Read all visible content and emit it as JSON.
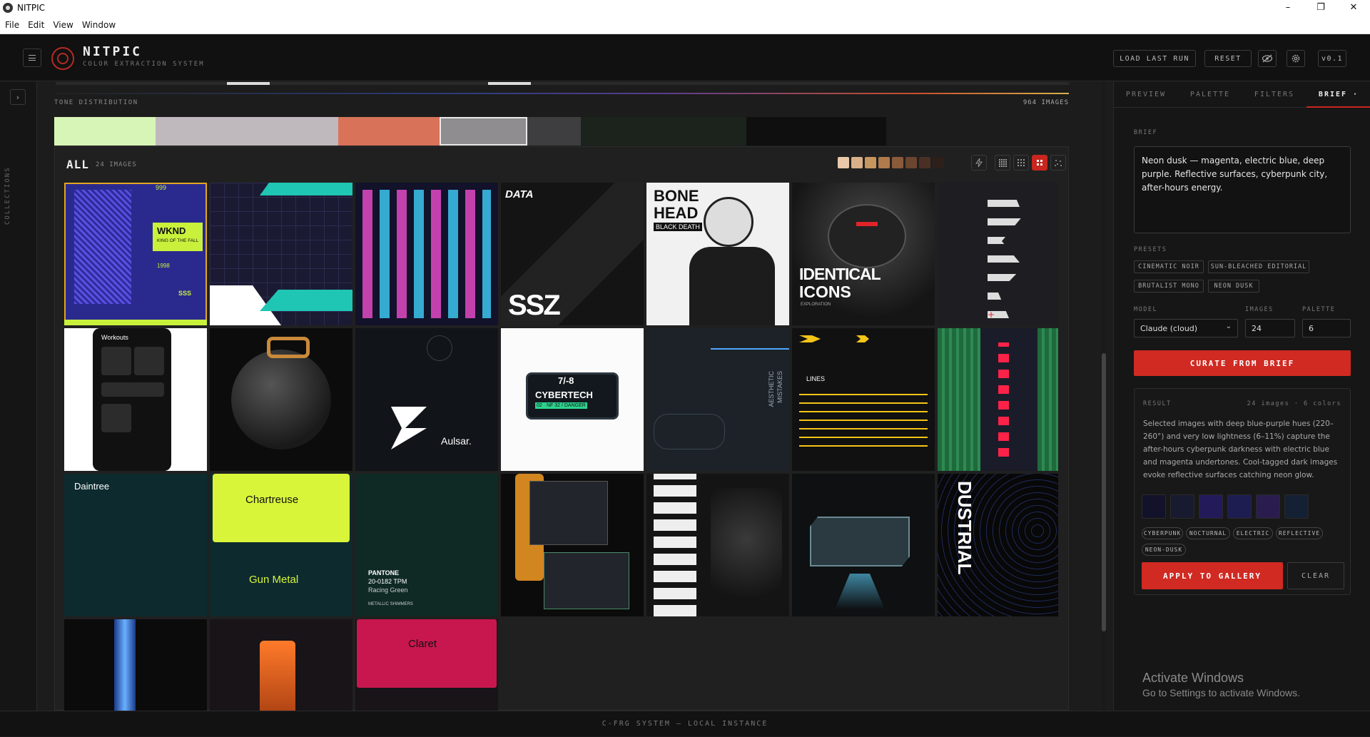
{
  "window": {
    "title": "NITPIC",
    "controls": [
      "–",
      "❐",
      "✕"
    ]
  },
  "menubar": {
    "items": [
      "File",
      "Edit",
      "View",
      "Window"
    ]
  },
  "header": {
    "brand": "NITPIC",
    "subtitle": "COLOR EXTRACTION SYSTEM",
    "load_last_run": "LOAD LAST RUN",
    "reset": "RESET",
    "version": "v0.1",
    "icons": [
      "menu-icon",
      "logo-icon",
      "eye-off-icon",
      "gear-icon"
    ]
  },
  "rail": {
    "expand": "›",
    "label": "COLLECTIONS"
  },
  "tone": {
    "label": "TONE DISTRIBUTION",
    "count": "964 IMAGES",
    "segments": [
      {
        "color": "#d8f5b8",
        "share": 0.1
      },
      {
        "color": "#bfb9be",
        "share": 0.18
      },
      {
        "color": "#d8735a",
        "share": 0.1
      },
      {
        "color": "#8f8d90",
        "share": 0.086,
        "selected": true
      },
      {
        "color": "#3e3e40",
        "share": 0.053
      },
      {
        "color": "#1c221c",
        "share": 0.163
      },
      {
        "color": "#0f0f0f",
        "share": 0.138
      }
    ]
  },
  "gallery": {
    "title": "ALL",
    "count": "24 IMAGES",
    "swatches": [
      "#e9c9a8",
      "#d8b08a",
      "#c7965f",
      "#b07a4c",
      "#8a5a3a",
      "#6b4530",
      "#4a2f24",
      "#2d1f1a"
    ],
    "tools": [
      "bolt-icon",
      "grid-dense-icon",
      "grid-medium-icon",
      "grid-large-icon",
      "scatter-icon"
    ],
    "tiles": [
      {
        "texts": [
          "WKND",
          "KING OF THE FALL",
          "1998",
          "SSS",
          "999"
        ]
      },
      {
        "texts": []
      },
      {
        "texts": []
      },
      {
        "texts": [
          "DATA",
          "SSZ"
        ]
      },
      {
        "texts": [
          "BONE",
          "HEAD",
          "BLACK DEATH"
        ]
      },
      {
        "texts": [
          "IDENTICAL",
          "ICONS",
          "EXPLORATION"
        ]
      },
      {
        "texts": []
      },
      {
        "texts": [
          "Workouts"
        ]
      },
      {
        "texts": []
      },
      {
        "texts": [
          "Aulsar."
        ]
      },
      {
        "texts": [
          "7/-8",
          "CYBERTECH",
          "02 · NF 32 / DANGER"
        ]
      },
      {
        "texts": [
          "AESTHETIC",
          "MISTAKES"
        ]
      },
      {
        "texts": [
          "LINES"
        ]
      },
      {
        "texts": []
      },
      {
        "texts": [
          "Daintree"
        ]
      },
      {
        "texts": [
          "Chartreuse",
          "Gun Metal"
        ]
      },
      {
        "texts": [
          "PANTONE",
          "20-0182 TPM",
          "Racing Green",
          "METALLIC SHIMMERS"
        ]
      },
      {
        "texts": []
      },
      {
        "texts": []
      },
      {
        "texts": []
      },
      {
        "texts": [
          "DUSTRIAL"
        ]
      },
      {
        "texts": []
      },
      {
        "texts": []
      },
      {
        "texts": [
          "Claret"
        ]
      }
    ]
  },
  "right": {
    "tabs": [
      "PREVIEW",
      "PALETTE",
      "FILTERS",
      "BRIEF ·"
    ],
    "active_tab": "BRIEF ·",
    "brief_label": "BRIEF",
    "brief_text": "Neon dusk — magenta, electric blue, deep purple. Reflective surfaces, cyberpunk city, after-hours energy.",
    "presets_label": "PRESETS",
    "presets": [
      "CINEMATIC NOIR",
      "SUN-BLEACHED EDITORIAL",
      "BRUTALIST MONO",
      "NEON DUSK"
    ],
    "model_label": "MODEL",
    "images_label": "IMAGES",
    "palette_label": "PALETTE",
    "model_value": "Claude (cloud)",
    "images_value": "24",
    "palette_value": "6",
    "curate": "CURATE FROM BRIEF",
    "result_label": "RESULT",
    "result_meta": "24 images · 6 colors",
    "result_text": "Selected images with deep blue-purple hues (220–260°) and very low lightness (6–11%) capture the after-hours cyberpunk darkness with electric blue and magenta undertones. Cool-tagged dark images evoke reflective surfaces catching neon glow.",
    "result_colors": [
      "#12132a",
      "#181a30",
      "#231a5a",
      "#1d1d52",
      "#2a1d4e",
      "#142033"
    ],
    "tags": [
      "CYBERPUNK",
      "NOCTURNAL",
      "ELECTRIC",
      "REFLECTIVE",
      "NEON-DUSK"
    ],
    "apply": "APPLY TO GALLERY",
    "clear": "CLEAR"
  },
  "watermark": {
    "line1": "Activate Windows",
    "line2": "Go to Settings to activate Windows."
  },
  "footer": "C-FRG SYSTEM — LOCAL INSTANCE"
}
